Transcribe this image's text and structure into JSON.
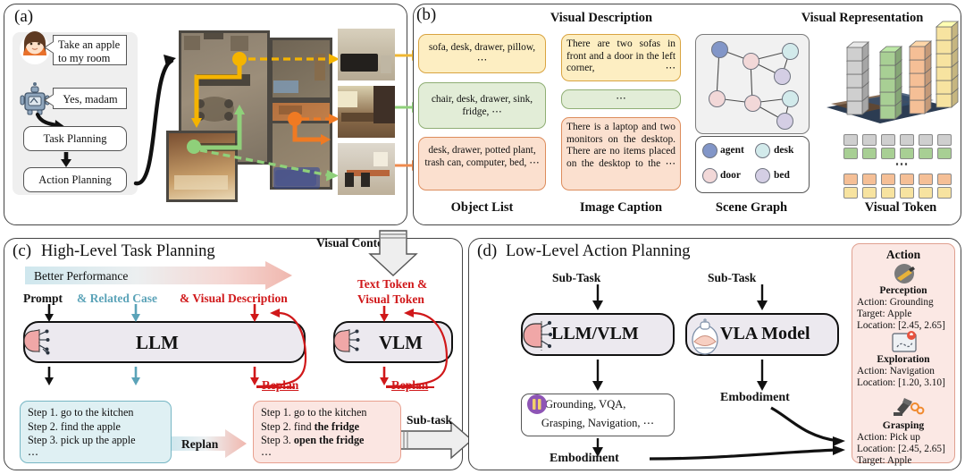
{
  "figure": {
    "panels": [
      {
        "tag": "(a)",
        "title": ""
      },
      {
        "tag": "(b)",
        "title": ""
      },
      {
        "tag": "(c)",
        "title": "High-Level Task Planning"
      },
      {
        "tag": "(d)",
        "title": "Low-Level Action Planning"
      }
    ]
  },
  "panel_a": {
    "tag": "(a)",
    "user_bubble": "Take an apple to my room",
    "robot_bubble": "Yes, madam",
    "boxes": [
      "Task Planning",
      "Action Planning"
    ],
    "icons": {
      "user": "woman-avatar-icon",
      "robot": "robot-icon"
    },
    "route_colors": {
      "yellow": "#f5b400",
      "green": "#8fd07a",
      "orange": "#ef7a23"
    },
    "views": [
      "living-room-view",
      "kitchen-view",
      "office-view"
    ]
  },
  "panel_b": {
    "tag": "(b)",
    "headers": {
      "left": "Visual Description",
      "right": "Visual Representation"
    },
    "columns": [
      "Object List",
      "Image Caption",
      "Scene Graph",
      "Visual Token"
    ],
    "object_list": [
      "sofa, desk, drawer, pillow, ⋯",
      "chair, desk, drawer, sink, fridge, ⋯",
      "desk, drawer, potted plant, trash can, computer, bed, ⋯"
    ],
    "image_caption": [
      "There are two sofas in front and a door in the left corner, ⋯",
      "⋯",
      "There is a laptop and two monitors on the desktop. There are no items placed on the desktop to the ⋯"
    ],
    "scene_graph_legend": [
      {
        "label": "agent",
        "color": "#8296c8"
      },
      {
        "label": "desk",
        "color": "#d2eaeb"
      },
      {
        "label": "door",
        "color": "#f2d8d8"
      },
      {
        "label": "bed",
        "color": "#d4cee4"
      }
    ],
    "visual_token_ellipsis": "⋯",
    "token_colors": [
      "#cfcfcf",
      "#a8cf94",
      "#f5bf96",
      "#f7e3a0"
    ]
  },
  "panel_c": {
    "tag": "(c)",
    "title": "High-Level Task Planning",
    "gradient_arrow_label": "Better Performance",
    "inputs": [
      {
        "text": "Prompt",
        "color": "#111111"
      },
      {
        "text": "& Related Case",
        "color": "#5ba3b8"
      },
      {
        "text": "& Visual Description",
        "color": "#d0181a"
      }
    ],
    "vlm_input_line1": "Text Token &",
    "vlm_input_line2": "Visual Token",
    "visual_context_label": "Visual Context",
    "models": [
      "LLM",
      "VLM"
    ],
    "replan_label": "Replan",
    "replan_arrow_label": "Replan",
    "plan_left": [
      "Step 1. go to the kitchen",
      "Step 2. find the apple",
      "Step 3. pick up the apple",
      "⋯"
    ],
    "plan_right_plain": [
      "Step 1. go to the kitchen",
      "Step 2. find ",
      "Step 3. ",
      "⋯"
    ],
    "plan_right_bold": [
      "",
      "the fridge",
      "open the fridge",
      ""
    ],
    "subtask_label": "Sub-task"
  },
  "panel_d": {
    "tag": "(d)",
    "title": "Low-Level Action Planning",
    "subtask_left": "Sub-Task",
    "subtask_right": "Sub-Task",
    "model_left": "LLM/VLM",
    "model_right": "VLA Model",
    "capability_line1": "Grounding, VQA,",
    "capability_line2": "Grasping, Navigation, ⋯",
    "embodiment_left": "Embodiment",
    "embodiment_right": "Embodiment",
    "action_card": {
      "title": "Action",
      "items": [
        {
          "icon": "perception-eye-icon",
          "name": "Perception",
          "lines": [
            "Action: Grounding",
            "Target: Apple",
            "Location: [2.45, 2.65]"
          ]
        },
        {
          "icon": "exploration-map-icon",
          "name": "Exploration",
          "lines": [
            "Action: Navigation",
            "Location: [1.20, 3.10]"
          ]
        },
        {
          "icon": "grasping-arm-icon",
          "name": "Grasping",
          "lines": [
            "Action: Pick up",
            "Location: [2.45, 2.65]",
            "Target: Apple"
          ]
        }
      ]
    }
  },
  "colors": {
    "red": "#d0181a",
    "cyan": "#5ba3b8",
    "yellow": "#f0b732",
    "green": "#8fd07a",
    "orange": "#ef8b4e",
    "model_fill": "#ece9ef"
  }
}
